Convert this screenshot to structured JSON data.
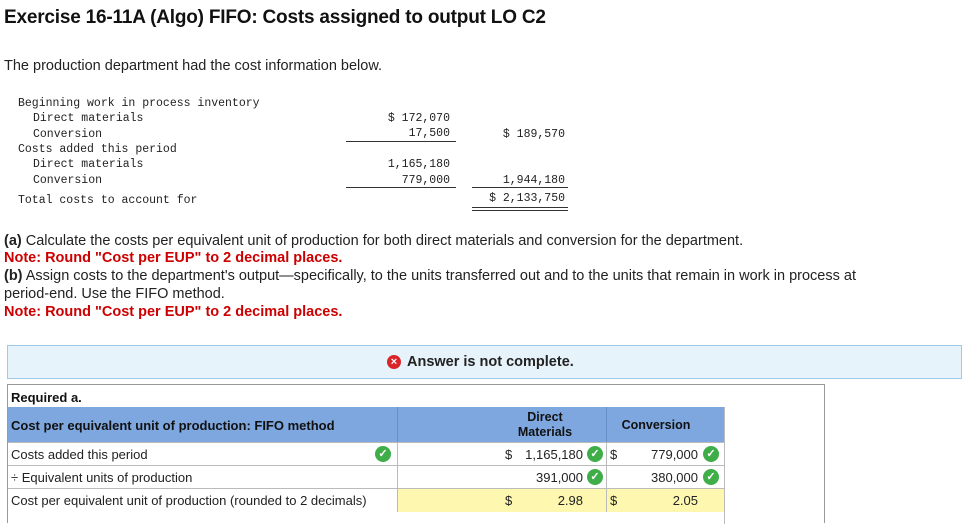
{
  "title": "Exercise 16-11A (Algo) FIFO: Costs assigned to output LO C2",
  "intro": "The production department had the cost information below.",
  "cost_info": {
    "beginning_wip_label": "Beginning work in process inventory",
    "bwip_dm_label": "Direct materials",
    "bwip_dm_value": "$ 172,070",
    "bwip_conv_label": "Conversion",
    "bwip_conv_value": "17,500",
    "bwip_total": "$ 189,570",
    "added_label": "Costs added this period",
    "added_dm_label": "Direct materials",
    "added_dm_value": "1,165,180",
    "added_conv_label": "Conversion",
    "added_conv_value": "779,000",
    "added_total": "1,944,180",
    "total_label": "Total costs to account for",
    "total_value": "$ 2,133,750"
  },
  "questions": {
    "a_label": "(a)",
    "a_text": " Calculate the costs per equivalent unit of production for both direct materials and conversion for the department.",
    "a_note": "Note: Round \"Cost per EUP\" to 2 decimal places.",
    "b_label": "(b)",
    "b_text": " Assign costs to the department's output—specifically, to the units transferred out and to the units that remain in work in process at",
    "b_text2": "period-end. Use the FIFO method.",
    "b_note": "Note: Round \"Cost per EUP\" to 2 decimal places."
  },
  "banner": {
    "message": "Answer is not complete."
  },
  "table": {
    "required_label": "Required a.",
    "header_label": "Cost per equivalent unit of production: FIFO method",
    "col_dm_line1": "Direct",
    "col_dm_line2": "Materials",
    "col_conv": "Conversion",
    "rows": [
      {
        "label": "Costs added this period",
        "dm_prefix": "$",
        "dm_value": "1,165,180",
        "conv_prefix": "$",
        "conv_value": "779,000"
      },
      {
        "label": "÷ Equivalent units of production",
        "dm_prefix": "",
        "dm_value": "391,000",
        "conv_prefix": "",
        "conv_value": "380,000"
      },
      {
        "label": "Cost per equivalent unit of production (rounded to 2 decimals)",
        "dm_prefix": "$",
        "dm_value": "2.98",
        "conv_prefix": "$",
        "conv_value": "2.05"
      }
    ],
    "check_glyph": "✓",
    "x_glyph": "×"
  },
  "colors": {
    "header_bg": "#7ea7df",
    "banner_bg": "#e6f3fb",
    "note_red": "#cc0000",
    "check_green": "#3fae49",
    "answer_yellow": "#fdf7b0"
  }
}
